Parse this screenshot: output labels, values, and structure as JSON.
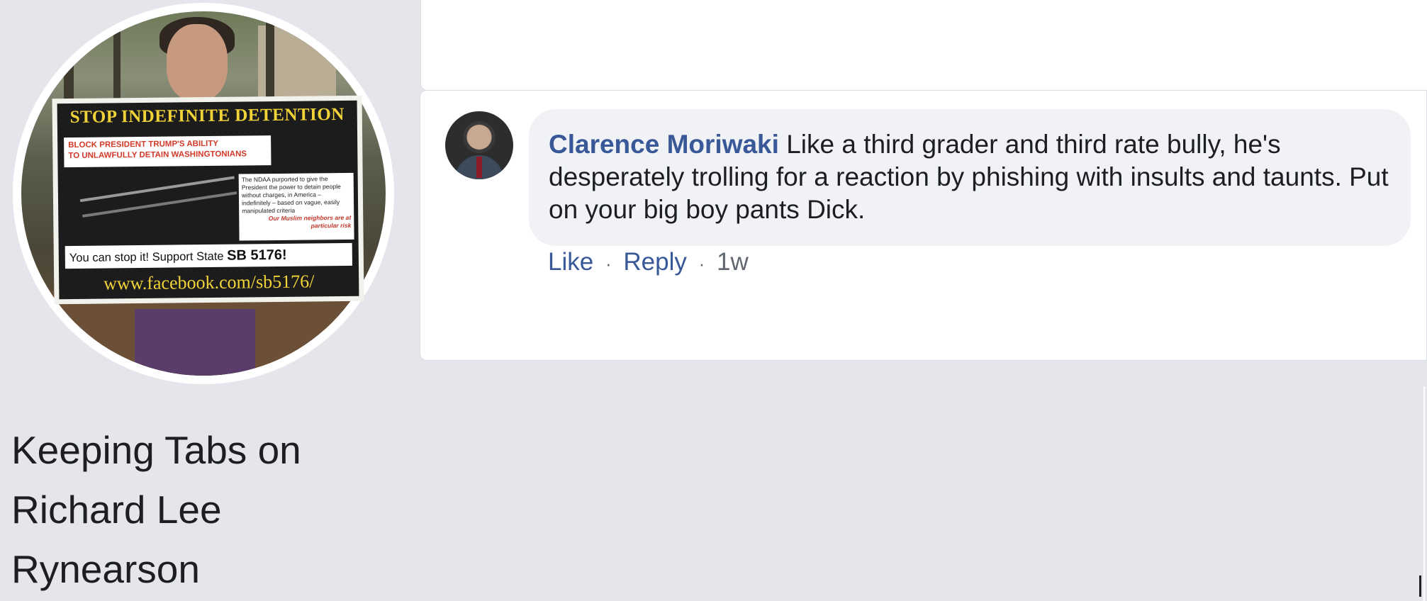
{
  "page": {
    "name_lines": [
      "Keeping Tabs on",
      "Richard Lee",
      "Rynearson"
    ]
  },
  "profile_sign": {
    "title": "STOP INDEFINITE DETENTION",
    "block_line1": "BLOCK PRESIDENT TRUMP'S ABILITY",
    "block_line2": "TO UNLAWFULLY DETAIN WASHINGTONIANS",
    "notes": "The NDAA purported to give the President the power to detain people without charges, in America – indefinitely – based on vague, easily manipulated criteria",
    "notes_highlight": "Our Muslim neighbors are at particular risk",
    "call_to_action": "You can stop it! Support State",
    "bill": "SB 5176!",
    "url": "www.facebook.com/sb5176/"
  },
  "comment": {
    "author": "Clarence Moriwaki",
    "text": "Like a third grader and third rate bully, he's desperately trolling for a reaction by phishing with insults and taunts. Put on your big boy pants Dick.",
    "actions": {
      "like": "Like",
      "reply": "Reply",
      "separator": "·",
      "time": "1w"
    }
  },
  "colors": {
    "background": "#e4e6ec",
    "link": "#385898",
    "bubble": "#f0f2f5",
    "meta": "#606770"
  }
}
